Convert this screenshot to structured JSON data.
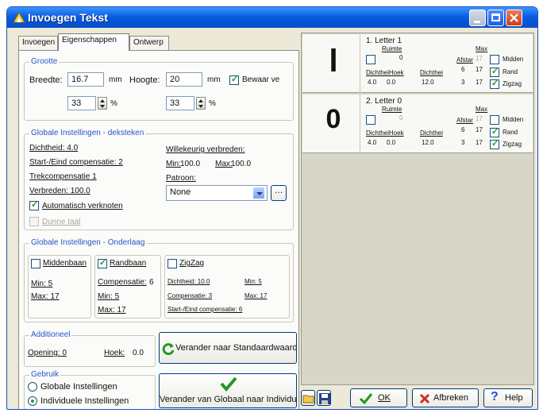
{
  "window": {
    "title": "Invoegen Tekst",
    "close_icon": "close-icon",
    "accent": "#0454d8"
  },
  "tabs": [
    {
      "label": "Invoegen"
    },
    {
      "label": "Eigenschappen"
    },
    {
      "label": "Ontwerp"
    }
  ],
  "grootte": {
    "title": "Grootte",
    "breedte_label": "Breedte:",
    "breedte_value": "16.7",
    "breedte_unit": "mm",
    "hoogte_label": "Hoogte:",
    "hoogte_value": "20",
    "hoogte_unit": "mm",
    "bewaar_label": "Bewaar ve",
    "bewaar_checked": true,
    "pct1_value": "33",
    "pct2_value": "33",
    "pct_unit": "%"
  },
  "dek": {
    "title": "Globale Instellingen - deksteken",
    "dichtheid": "Dichtheid: 4.0",
    "start_eind": "Start-/Eind compensatie: 2",
    "trek": "Trekcompensatie 1",
    "verbreden": "Verbreden: 100.0",
    "auto_label": "Automatisch verknoten",
    "auto_checked": true,
    "dunne_label": "Dunne taal",
    "willekeurig": "Willekeurig verbreden:",
    "min_label": "Min:",
    "min_value": "100.0",
    "max_label": "Max:",
    "max_value": "100.0",
    "patroon_label": "Patroon:",
    "patroon_value": "None"
  },
  "onder": {
    "title": "Globale Instellingen - Onderlaag",
    "midden_label": "Middenbaan",
    "midden_checked": false,
    "midden_min": "Min: 5",
    "midden_max": "Max: 17",
    "rand_label": "Randbaan",
    "rand_checked": true,
    "rand_comp_label": "Compensatie:",
    "rand_comp_value": "6",
    "rand_min": "Min: 5",
    "rand_max": "Max: 17",
    "zig_label": "ZigZag",
    "zig_checked": false,
    "zig_dichtheid": "Dichtheid: 10.0",
    "zig_min": "Min: 5",
    "zig_comp": "Compensatie: 3",
    "zig_max": "Max: 17",
    "zig_start": "Start-/Eind compensatie: 6"
  },
  "additioneel": {
    "title": "Additioneel",
    "opening": "Opening: 0",
    "hoek_label": "Hoek:",
    "hoek_value": "0.0",
    "std_button": "Verander naar Standaardwaarde"
  },
  "gebruik": {
    "title": "Gebruik",
    "radio_globale": "Globale Instellingen",
    "radio_individuele": "Individuele Instellingen",
    "selected": "individuele",
    "big_button": "Verander van Globaal naar Individuee"
  },
  "letters": [
    {
      "header": "1. Letter 1",
      "glyph": "l",
      "ruimte_label": "Ruimte",
      "ruimte_value": "0",
      "max_label": "Max",
      "afstar_label": "Afstar",
      "afstar_value": "17",
      "dh_label": "DichtheiHoek",
      "dh_d": "4.0",
      "dh_h": "0.0",
      "dicht_label": "Dichthei",
      "dicht_value": "12.0",
      "min_vals": [
        "6",
        "3"
      ],
      "max_vals": [
        "17",
        "17"
      ],
      "midden_label": "Midden",
      "midden_checked": false,
      "rand_label": "Rand",
      "rand_checked": true,
      "zigzag_label": "Zigzag",
      "zigzag_checked": true
    },
    {
      "header": "2. Letter 0",
      "glyph": "0",
      "ruimte_label": "Ruimte",
      "ruimte_value": "0",
      "max_label": "Max",
      "afstar_label": "Afstar",
      "afstar_value": "17",
      "dh_label": "DichtheiHoek",
      "dh_d": "4.0",
      "dh_h": "0.0",
      "dicht_label": "Dichthei",
      "dicht_value": "12.0",
      "min_vals": [
        "6",
        "3"
      ],
      "max_vals": [
        "17",
        "17"
      ],
      "midden_label": "Midden",
      "midden_checked": false,
      "rand_label": "Rand",
      "rand_checked": true,
      "zigzag_label": "Zigzag",
      "zigzag_checked": true
    }
  ],
  "buttons": {
    "ok": "OK",
    "ok_icon": "check-icon",
    "abbreken": "Afbreken",
    "abbreken_icon": "cross-icon",
    "help": "Help",
    "help_icon": "question-icon",
    "open_icon": "open-folder-icon",
    "save_icon": "save-icon"
  }
}
